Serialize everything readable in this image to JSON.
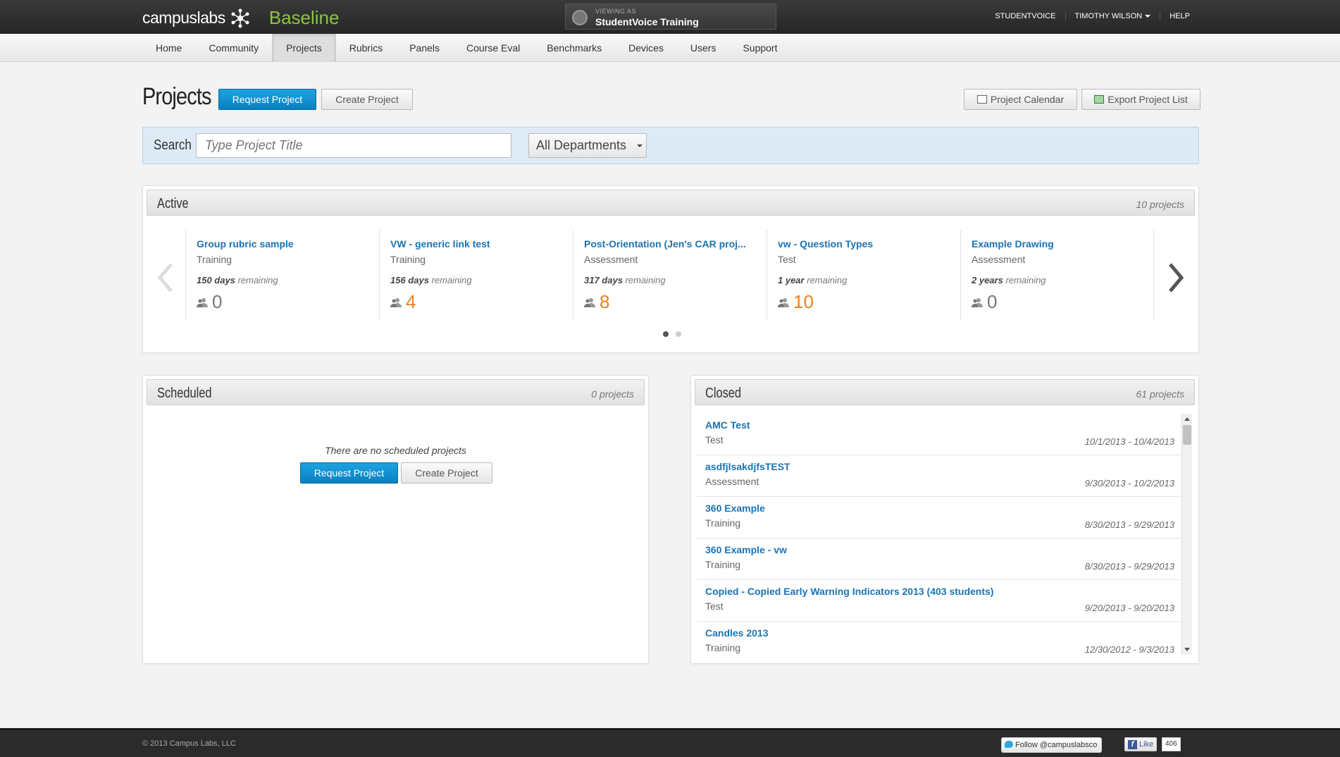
{
  "brand": {
    "name": "campuslabs",
    "product": "Baseline"
  },
  "viewing_as": {
    "label": "VIEWING AS",
    "value": "StudentVoice Training"
  },
  "top_links": {
    "org": "STUDENTVOICE",
    "user": "TIMOTHY WILSON",
    "help": "HELP"
  },
  "nav": {
    "items": [
      "Home",
      "Community",
      "Projects",
      "Rubrics",
      "Panels",
      "Course Eval",
      "Benchmarks",
      "Devices",
      "Users",
      "Support"
    ],
    "active": "Projects"
  },
  "page": {
    "title": "Projects",
    "request_btn": "Request Project",
    "create_btn": "Create Project",
    "calendar_btn": "Project Calendar",
    "export_btn": "Export Project List"
  },
  "search": {
    "label": "Search",
    "placeholder": "Type Project Title",
    "department": "All Departments"
  },
  "active": {
    "title": "Active",
    "count": "10 projects",
    "cards": [
      {
        "title": "Group rubric sample",
        "type": "Training",
        "remaining_value": "150 days",
        "remaining_suffix": "remaining",
        "users": "0"
      },
      {
        "title": "VW - generic link test",
        "type": "Training",
        "remaining_value": "156 days",
        "remaining_suffix": "remaining",
        "users": "4"
      },
      {
        "title": "Post-Orientation (Jen's CAR proj...",
        "type": "Assessment",
        "remaining_value": "317 days",
        "remaining_suffix": "remaining",
        "users": "8"
      },
      {
        "title": "vw - Question Types",
        "type": "Test",
        "remaining_value": "1 year",
        "remaining_suffix": "remaining",
        "users": "10"
      },
      {
        "title": "Example Drawing",
        "type": "Assessment",
        "remaining_value": "2 years",
        "remaining_suffix": "remaining",
        "users": "0"
      }
    ]
  },
  "scheduled": {
    "title": "Scheduled",
    "count": "0 projects",
    "empty": "There are no scheduled projects",
    "request_btn": "Request Project",
    "create_btn": "Create Project"
  },
  "closed": {
    "title": "Closed",
    "count": "61 projects",
    "rows": [
      {
        "name": "AMC Test",
        "type": "Test",
        "dates": "10/1/2013 - 10/4/2013"
      },
      {
        "name": "asdfjlsakdjfsTEST",
        "type": "Assessment",
        "dates": "9/30/2013 - 10/2/2013"
      },
      {
        "name": "360 Example",
        "type": "Training",
        "dates": "8/30/2013 - 9/29/2013"
      },
      {
        "name": "360 Example - vw",
        "type": "Training",
        "dates": "8/30/2013 - 9/29/2013"
      },
      {
        "name": "Copied - Copied Early Warning Indicators 2013 (403 students)",
        "type": "Test",
        "dates": "9/20/2013 - 9/20/2013"
      },
      {
        "name": "Candles 2013",
        "type": "Training",
        "dates": "12/30/2012 - 9/3/2013"
      }
    ]
  },
  "footer": {
    "copyright": "© 2013 Campus Labs, LLC",
    "twitter": "Follow @campuslabsco",
    "like": "Like",
    "like_count": "406"
  },
  "colors": {
    "accent": "#1a73b4",
    "brand_green": "#8cc63f",
    "orange": "#f07f1b",
    "primary_btn": "#0a7fc2"
  }
}
